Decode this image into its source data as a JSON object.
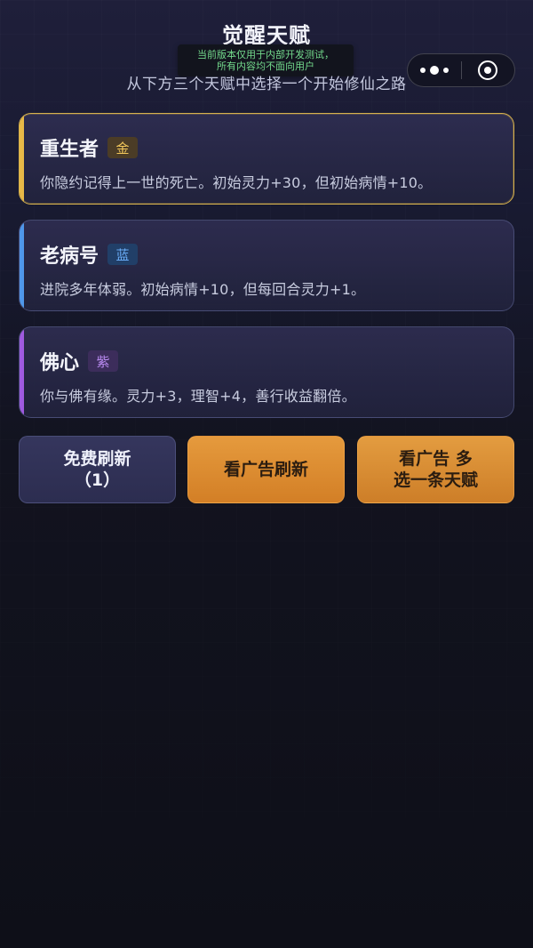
{
  "page": {
    "title": "觉醒天赋",
    "subtitle": "从下方三个天赋中选择一个开始修仙之路",
    "notice_lines": [
      "当前版本仅用于内部开发测试，",
      "所有内容均不面向用户"
    ]
  },
  "capsule": {
    "menu_icon": "more-dots-icon",
    "close_icon": "miniapp-close-icon"
  },
  "cards": [
    {
      "title": "重生者",
      "badge": "金",
      "description": "你隐约记得上一世的死亡。初始灵力+30，但初始病情+10。",
      "accent": "#e8b947",
      "badge_bg": "#4b3c26",
      "badge_fg": "#f2c75b",
      "selected": true
    },
    {
      "title": "老病号",
      "badge": "蓝",
      "description": "进院多年体弱。初始病情+10，但每回合灵力+1。",
      "accent": "#4f97ea",
      "badge_bg": "#213f68",
      "badge_fg": "#69abf5",
      "selected": false
    },
    {
      "title": "佛心",
      "badge": "紫",
      "description": "你与佛有缘。灵力+3，理智+4，善行收益翻倍。",
      "accent": "#9f5ae0",
      "badge_bg": "#3c2d5b",
      "badge_fg": "#b98af0",
      "selected": false
    }
  ],
  "actions": {
    "free_refresh": "免费刷新\n（1）",
    "ad_refresh": "看广告刷新",
    "ad_extra": "看广告 多\n选一条天赋"
  },
  "colors": {
    "primary_orange": "#d9862c",
    "secondary_button": "#2f3053",
    "background_top": "#1f1f3a",
    "background_bottom": "#0e0f18"
  }
}
